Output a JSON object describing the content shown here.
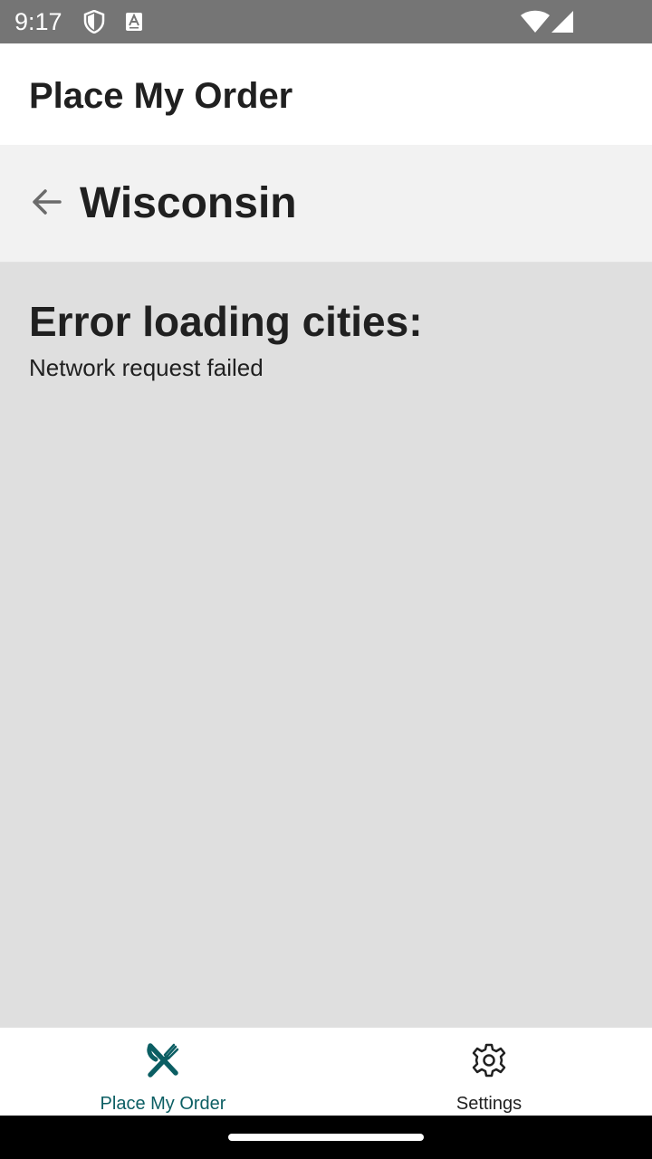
{
  "status_bar": {
    "time": "9:17",
    "icons": [
      "shield-icon",
      "font-a-icon",
      "wifi-icon",
      "signal-icon"
    ]
  },
  "app_header": {
    "title": "Place My Order"
  },
  "sub_header": {
    "back_icon": "arrow-left-icon",
    "title": "Wisconsin"
  },
  "content": {
    "error_heading": "Error loading cities:",
    "error_message": "Network request failed"
  },
  "bottom_nav": {
    "tabs": [
      {
        "label": "Place My Order",
        "icon": "fork-knife-icon",
        "active": true
      },
      {
        "label": "Settings",
        "icon": "gear-icon",
        "active": false
      }
    ]
  },
  "colors": {
    "status_bar_bg": "#757575",
    "active_tab": "#0b5e63",
    "inactive_tab": "#202020",
    "content_bg": "#dfdfdf",
    "sub_header_bg": "#f2f2f2"
  }
}
